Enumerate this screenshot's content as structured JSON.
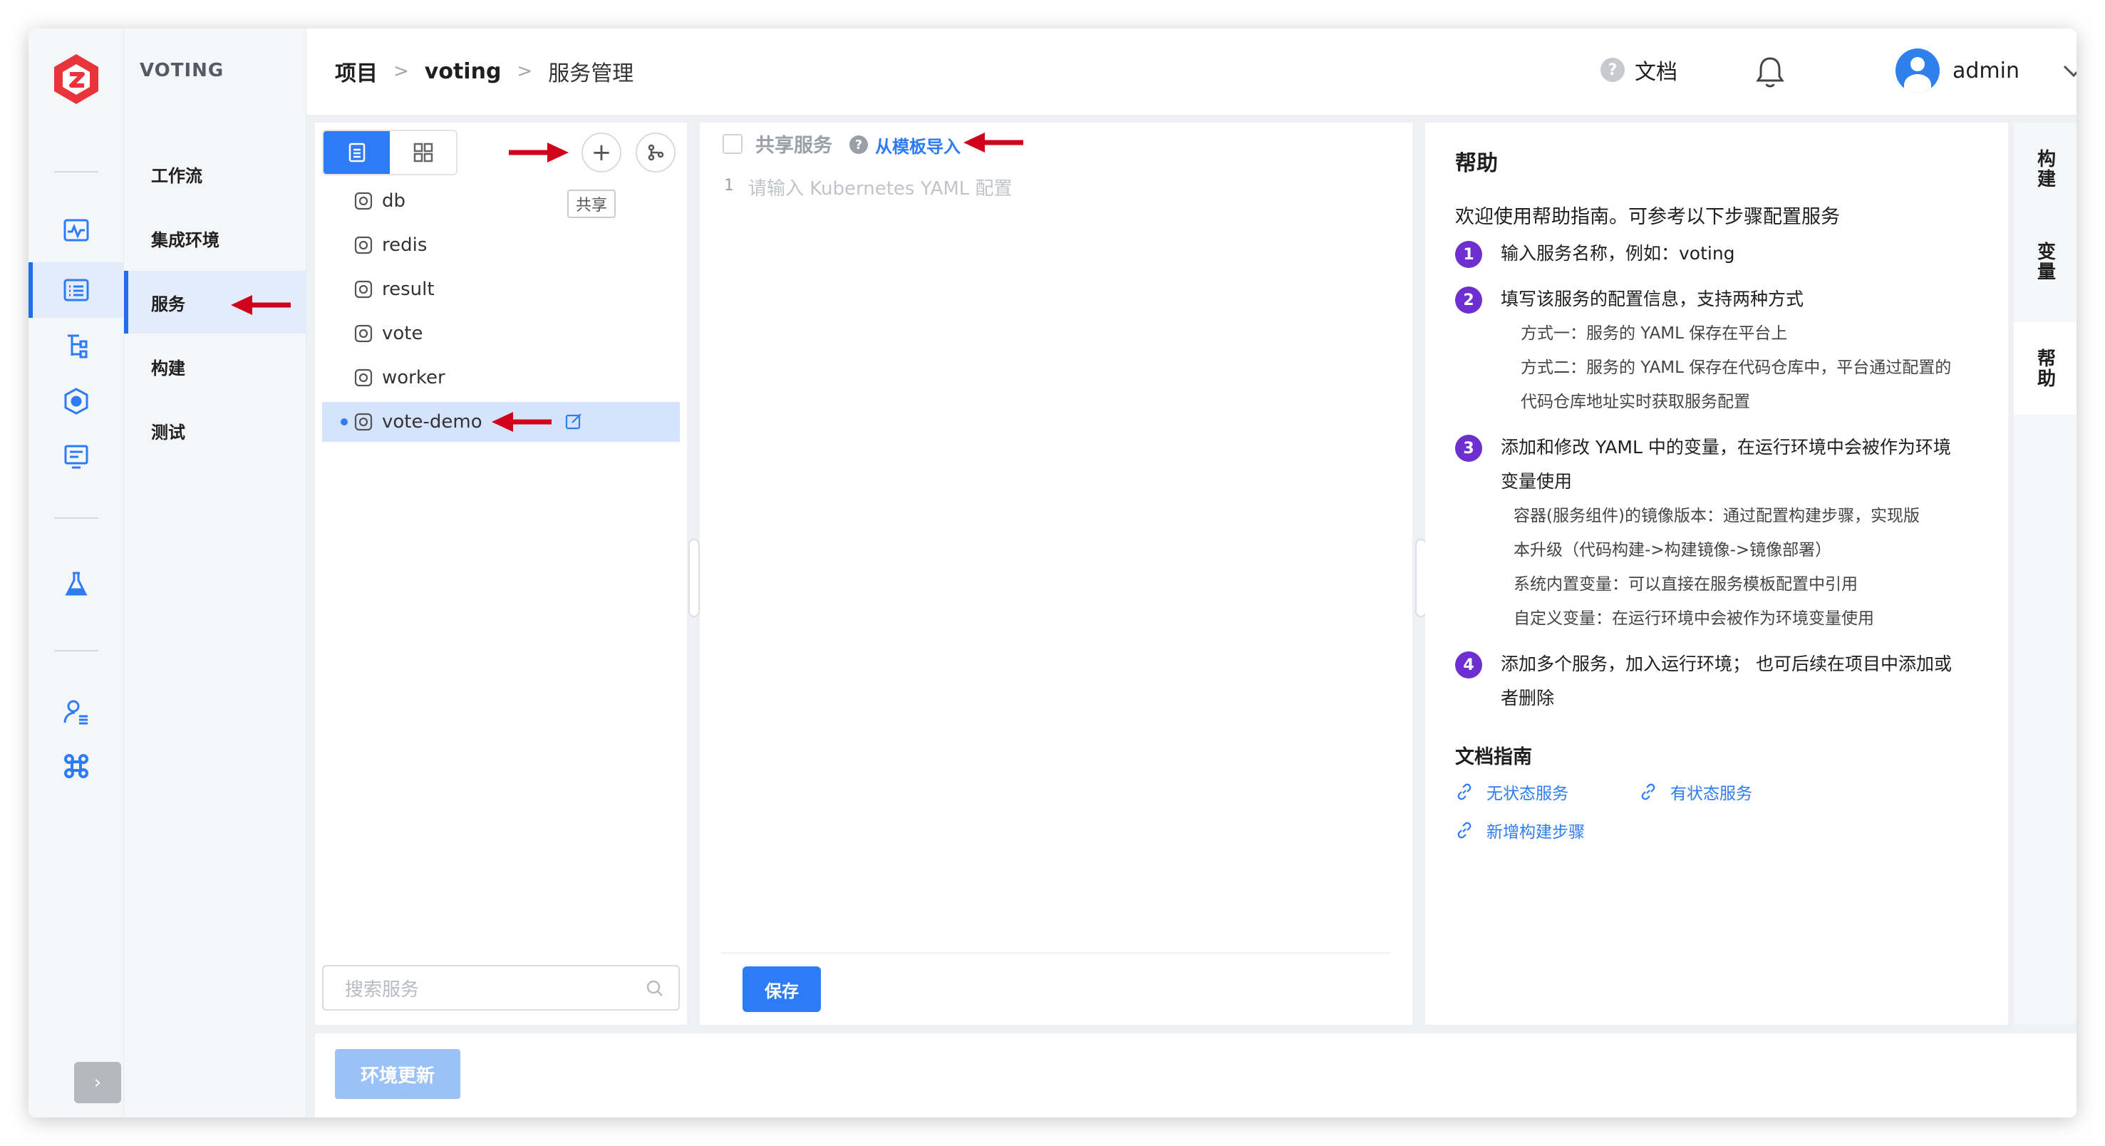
{
  "app": {
    "name": "VOTING"
  },
  "sidebar": {
    "items": [
      {
        "label": "工作流"
      },
      {
        "label": "集成环境"
      },
      {
        "label": "服务"
      },
      {
        "label": "构建"
      },
      {
        "label": "测试"
      }
    ],
    "active_index": 2
  },
  "header": {
    "breadcrumb": [
      "项目",
      "voting",
      "服务管理"
    ],
    "breadcrumb_sep": ">",
    "docs_label": "文档",
    "user_name": "admin"
  },
  "services": {
    "items": [
      "db",
      "redis",
      "result",
      "vote",
      "worker",
      "vote-demo"
    ],
    "shared_tag": "共享",
    "active": "vote-demo",
    "search_placeholder": "搜索服务"
  },
  "editor": {
    "share_label": "共享服务",
    "import_link": "从模板导入",
    "line_number": "1",
    "placeholder": "请输入 Kubernetes YAML 配置",
    "save_label": "保存"
  },
  "help": {
    "title": "帮助",
    "intro": "欢迎使用帮助指南。可参考以下步骤配置服务",
    "steps": [
      {
        "num": "1",
        "text": "输入服务名称，例如：voting"
      },
      {
        "num": "2",
        "text": "填写该服务的配置信息，支持两种方式",
        "subs": [
          "方式一：服务的 YAML 保存在平台上",
          "方式二：服务的 YAML 保存在代码仓库中，平台通过配置的",
          "代码仓库地址实时获取服务配置"
        ]
      },
      {
        "num": "3",
        "text_1": "添加和修改 YAML 中的变量，在运行环境中会被作为环境",
        "text_2": "变量使用",
        "subs": [
          "容器(服务组件)的镜像版本：通过配置构建步骤，实现版",
          "本升级（代码构建->构建镜像->镜像部署）",
          "系统内置变量：可以直接在服务模板配置中引用",
          "自定义变量：在运行环境中会被作为环境变量使用"
        ]
      },
      {
        "num": "4",
        "text_1": "添加多个服务，加入运行环境；  也可后续在项目中添加或",
        "text_2": "者删除"
      }
    ],
    "docs_title": "文档指南",
    "doc_links": [
      "无状态服务",
      "有状态服务",
      "新增构建步骤"
    ]
  },
  "right_tabs": [
    "构建",
    "变量",
    "帮助"
  ],
  "right_tabs_active": "帮助",
  "bottom": {
    "env_update_label": "环境更新"
  },
  "colors": {
    "accent": "#2d7cf6",
    "step_badge": "#6e2fd0",
    "annotation_arrow": "#d0021b",
    "logo": "#e8343a"
  }
}
